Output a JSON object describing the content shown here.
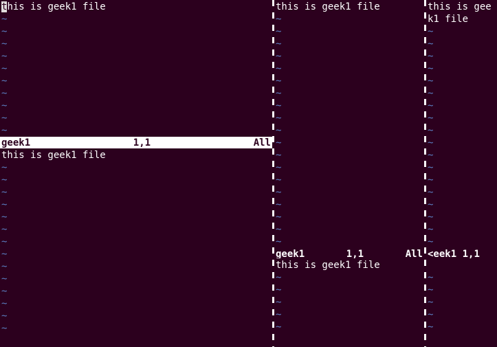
{
  "file_content": "this is geek1 file",
  "file_content_no_first": "his is geek1 file",
  "cursor_char": "t",
  "tilde": "~",
  "panes": {
    "left_top": {
      "status": {
        "fname": "geek1",
        "pos": "1,1",
        "pct": "All"
      },
      "active": true,
      "tilde_count": 10
    },
    "left_bot": {
      "status_visible": false,
      "tilde_count": 14
    },
    "mid_top": {
      "status": {
        "fname": "geek1",
        "pos": "1,1",
        "pct": "All"
      },
      "active": false,
      "tilde_count": 19
    },
    "mid_bot": {
      "status_visible": false,
      "tilde_count": 5
    },
    "right_top": {
      "status": {
        "fname": "<eek1",
        "pos": "1,1",
        "pct": ""
      },
      "active": false,
      "tilde_count": 18,
      "wrapped_text_line1": "this is gee",
      "wrapped_text_line2": "k1 file"
    },
    "right_bot": {
      "tilde_count": 5
    }
  }
}
